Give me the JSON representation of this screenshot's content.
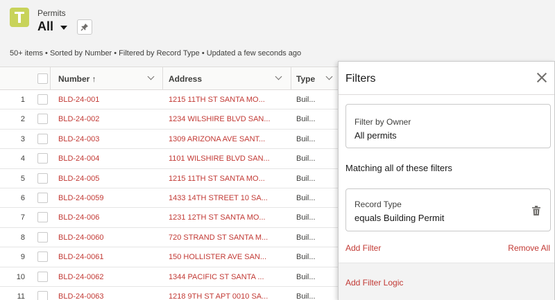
{
  "header": {
    "object_label": "Permits",
    "view_name": "All",
    "status": "50+ items • Sorted by Number • Filtered by Record Type • Updated a few seconds ago"
  },
  "table": {
    "columns": {
      "number": "Number ↑",
      "address": "Address",
      "type": "Type"
    },
    "rows": [
      {
        "n": "1",
        "number": "BLD-24-001",
        "address": "1215 11TH ST SANTA MO...",
        "type": "Buil..."
      },
      {
        "n": "2",
        "number": "BLD-24-002",
        "address": "1234 WILSHIRE BLVD SAN...",
        "type": "Buil..."
      },
      {
        "n": "3",
        "number": "BLD-24-003",
        "address": "1309 ARIZONA AVE SANT...",
        "type": "Buil..."
      },
      {
        "n": "4",
        "number": "BLD-24-004",
        "address": "1101 WILSHIRE BLVD SAN...",
        "type": "Buil..."
      },
      {
        "n": "5",
        "number": "BLD-24-005",
        "address": "1215 11TH ST SANTA MO...",
        "type": "Buil..."
      },
      {
        "n": "6",
        "number": "BLD-24-0059",
        "address": "1433 14TH STREET 10 SA...",
        "type": "Buil..."
      },
      {
        "n": "7",
        "number": "BLD-24-006",
        "address": "1231 12TH ST SANTA MO...",
        "type": "Buil..."
      },
      {
        "n": "8",
        "number": "BLD-24-0060",
        "address": "720 STRAND ST SANTA M...",
        "type": "Buil..."
      },
      {
        "n": "9",
        "number": "BLD-24-0061",
        "address": "150 HOLLISTER AVE SAN...",
        "type": "Buil..."
      },
      {
        "n": "10",
        "number": "BLD-24-0062",
        "address": "1344 PACIFIC ST SANTA ...",
        "type": "Buil..."
      },
      {
        "n": "11",
        "number": "BLD-24-0063",
        "address": "1218 9TH ST APT 0010 SA...",
        "type": "Buil..."
      }
    ]
  },
  "filters": {
    "title": "Filters",
    "owner_label": "Filter by Owner",
    "owner_value": "All permits",
    "matching": "Matching all of these filters",
    "record_type_label": "Record Type",
    "record_type_value": "equals Building Permit",
    "add_filter": "Add Filter",
    "remove_all": "Remove All",
    "add_filter_logic": "Add Filter Logic"
  },
  "icons": {
    "object": "permit-object-icon",
    "pin": "pin-icon",
    "close": "close-icon",
    "trash": "trash-icon",
    "sort": "sort-up-icon",
    "column_menu": "chevron-down-icon"
  },
  "colors": {
    "link": "#c23934",
    "object_icon_bg": "#c8d35a",
    "header_bg": "#f3f3f3"
  }
}
